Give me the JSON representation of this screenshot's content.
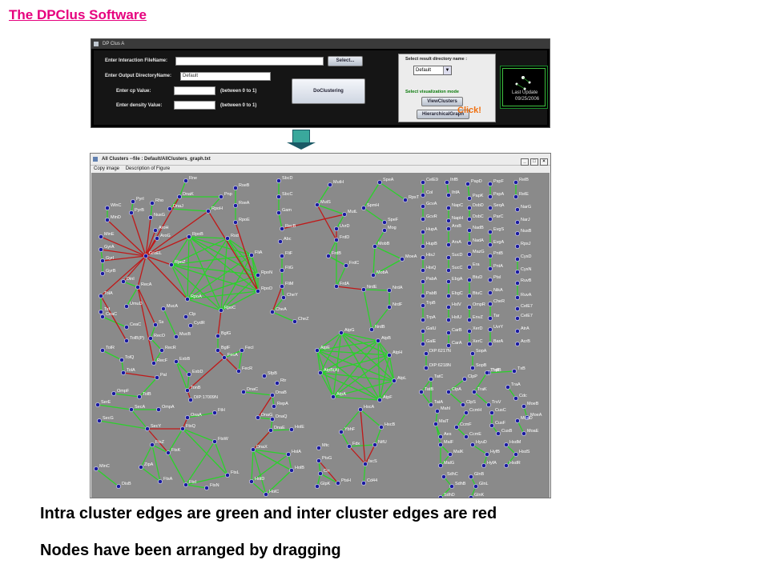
{
  "slide": {
    "title": "The DPClus Software",
    "caption1": "Intra cluster edges are green and inter cluster edges are red",
    "caption2": "Nodes have been arranged by dragging"
  },
  "dpclus_window": {
    "title": "DP Clus A",
    "interaction_label": "Enter Interaction FileName:",
    "interaction_value": "",
    "select_button": "Select...",
    "output_label": "Enter Output DirectoryName:",
    "output_value": "Default",
    "cp_label": "Enter cp Value:",
    "cp_hint": "(between 0 to 1)",
    "density_label": "Enter density Value:",
    "density_hint": "(between 0 to 1)",
    "cluster_button": "DoClustering",
    "result_dir_label": "Select result directory name :",
    "result_dir_value": "Default",
    "vis_mode_label": "Select visualization mode",
    "view_clusters_button": "ViewClusters",
    "hier_graph_button": "HierarchicalGraph",
    "click_note": "Click!",
    "thumb_line1": "Last Update",
    "thumb_line2": "09/25/2006"
  },
  "clusters_window": {
    "title": "All Clusters  --file : Default/AllClusters_graph.txt",
    "menu": [
      "Copy image",
      "Description of Figure"
    ],
    "controls": [
      "_",
      "□",
      "×"
    ]
  },
  "colors": {
    "title_pink": "#e6007e",
    "intra_edge": "#2ad22a",
    "inter_edge": "#c01818",
    "graph_bg": "#8a8a8a",
    "click_orange": "#f07010"
  },
  "graph": {
    "nodes": [
      "Rne",
      "RseB",
      "DnaK",
      "Pnp",
      "SbcD",
      "MutH",
      "SpeA",
      "CelE9",
      "IhfB",
      "PapD",
      "PspF",
      "RelB",
      "WlnC",
      "PyrI",
      "Rho",
      "DnaJ",
      "RpoH",
      "RseA",
      "SbcC",
      "MutS",
      "SpmH",
      "RpsT",
      "Col",
      "IhfA",
      "PapK",
      "PspA",
      "RelE",
      "MinD",
      "PyrB",
      "NusG",
      "Gam",
      "MutL",
      "SpeF",
      "GcvA",
      "NapC",
      "DsbD",
      "SeqA",
      "NarG",
      "MinE",
      "AroH",
      "AroG",
      "RpoE",
      "RecB",
      "UvrD",
      "Mog",
      "GcvR",
      "NapH",
      "DsbC",
      "ParC",
      "NarJ",
      "GyrA",
      "RpoB",
      "Rsd",
      "Abc2",
      "FrdD",
      "HupA",
      "ArsB",
      "NadB",
      "EvgS",
      "NusB",
      "GyrI",
      "GroEL",
      "FliA",
      "FliF",
      "FrdB",
      "MobB",
      "MoeA",
      "HupB",
      "ArsA",
      "NadA",
      "EvgA",
      "RpsJ",
      "GyrB",
      "RpoZ",
      "FliG",
      "FrdC",
      "HisJ",
      "SucD",
      "MazG",
      "PntB",
      "CysD",
      "DinI",
      "RpoN",
      "FliM",
      "MobA",
      "HisQ",
      "SucC",
      "Era",
      "PntA",
      "CysN",
      "TolA",
      "RecA",
      "RpoD",
      "CheY",
      "FrdA",
      "NrdE",
      "NrdA",
      "PabA",
      "EbgA",
      "BtuD",
      "PtsI",
      "RuvB",
      "Tsf",
      "UmuD",
      "RpoA",
      "CheA",
      "NrdF",
      "PabB",
      "EbgC",
      "BtuC",
      "NikA",
      "RuvA",
      "CeaC",
      "MucA",
      "RpoC",
      "Clp",
      "CheZ",
      "TrpB",
      "HslV",
      "OmpR",
      "CheR",
      "CelE7",
      "CeaC2",
      "Ssb",
      "CydR",
      "NrdB",
      "TrpA",
      "HslU",
      "EnvZ",
      "Tar",
      "CelE7b",
      "TolB(P)",
      "RecO",
      "MucB",
      "BglG",
      "GalU",
      "CarB",
      "XerD",
      "UvrY",
      "AtrA",
      "RecR",
      "BglF",
      "FecA",
      "FecI",
      "AtpG",
      "AtpB",
      "GalE",
      "CarA",
      "XerC",
      "BarA",
      "AcrB",
      "TolR",
      "TolQ",
      "RecF",
      "ExbB",
      "AtpE",
      "AtpH",
      "DIP:6217N",
      "SopA",
      "ExbD",
      "FecR",
      "DIP:6218N",
      "SopB",
      "TrpB2",
      "TxB",
      "TolA2",
      "Pal",
      "AtpB(A)",
      "AtpL",
      "TatC",
      "ClpP",
      "TrsB",
      "TraA",
      "OmpF",
      "TonB",
      "SfpB",
      "Rtr",
      "TatB",
      "ClpA",
      "TraK",
      "Cdc2",
      "TolB",
      "DIP:17009N",
      "DnaC",
      "DnaB",
      "AtpA",
      "AtpF",
      "TatA",
      "ClpS",
      "TrsV",
      "MoeB",
      "SerE",
      "SecA",
      "OmpA",
      "RepA",
      "HscA",
      "Mahl",
      "CcmH",
      "CusC",
      "MoeA2",
      "OxaA",
      "FtH",
      "DnaG",
      "DnaQ",
      "MalT",
      "CcmF",
      "CusF",
      "MoaD",
      "SecG",
      "SecY",
      "FtsQ",
      "DnaE",
      "HolE",
      "Aes",
      "CcmE",
      "CusB",
      "MoaE",
      "FtsW",
      "YbhF",
      "HscB",
      "MalF",
      "HyuD",
      "HsdM",
      "FtsZ",
      "FtsK",
      "DnaX",
      "Fdx",
      "NifU",
      "MalK",
      "HyfB",
      "HsdS",
      "MinC",
      "ZipA",
      "HolA",
      "Mtc",
      "MalG",
      "HyfA",
      "HsdR",
      "FtsL",
      "HolB",
      "PtsG",
      "IscS",
      "SdhC",
      "GlnB",
      "FtsA",
      "FtsI",
      "HolD",
      "Crr",
      "PtsH",
      "Cd44",
      "GlnL",
      "DisB",
      "FtsN",
      "HolC",
      "GlpK",
      "SdhD",
      "SdhB",
      "GlnK"
    ]
  }
}
